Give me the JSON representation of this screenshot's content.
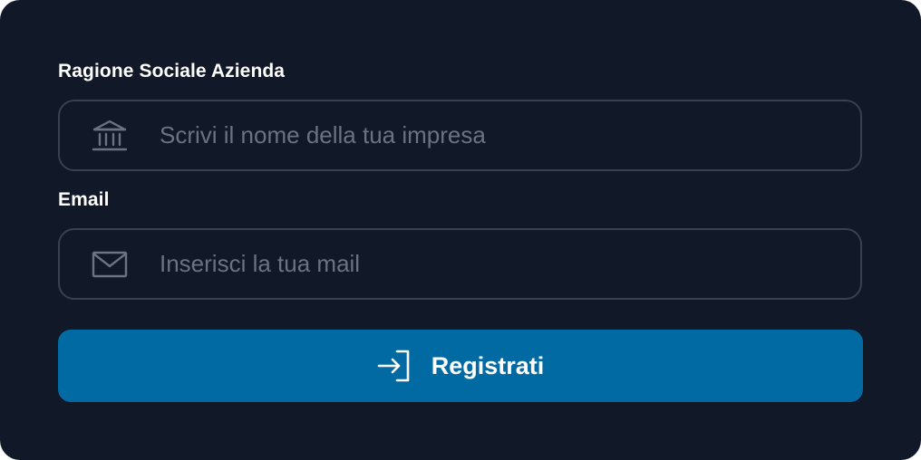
{
  "form": {
    "company": {
      "label": "Ragione Sociale Azienda",
      "placeholder": "Scrivi il nome della tua impresa",
      "value": "",
      "icon": "bank-icon"
    },
    "email": {
      "label": "Email",
      "placeholder": "Inserisci la tua mail",
      "value": "",
      "icon": "mail-icon"
    },
    "submit": {
      "label": "Registrati",
      "icon": "login-icon"
    }
  },
  "colors": {
    "background": "#111827",
    "field_border": "#374151",
    "placeholder": "#6b7280",
    "icon": "#6b7280",
    "button": "#026aa2",
    "text": "#ffffff"
  }
}
